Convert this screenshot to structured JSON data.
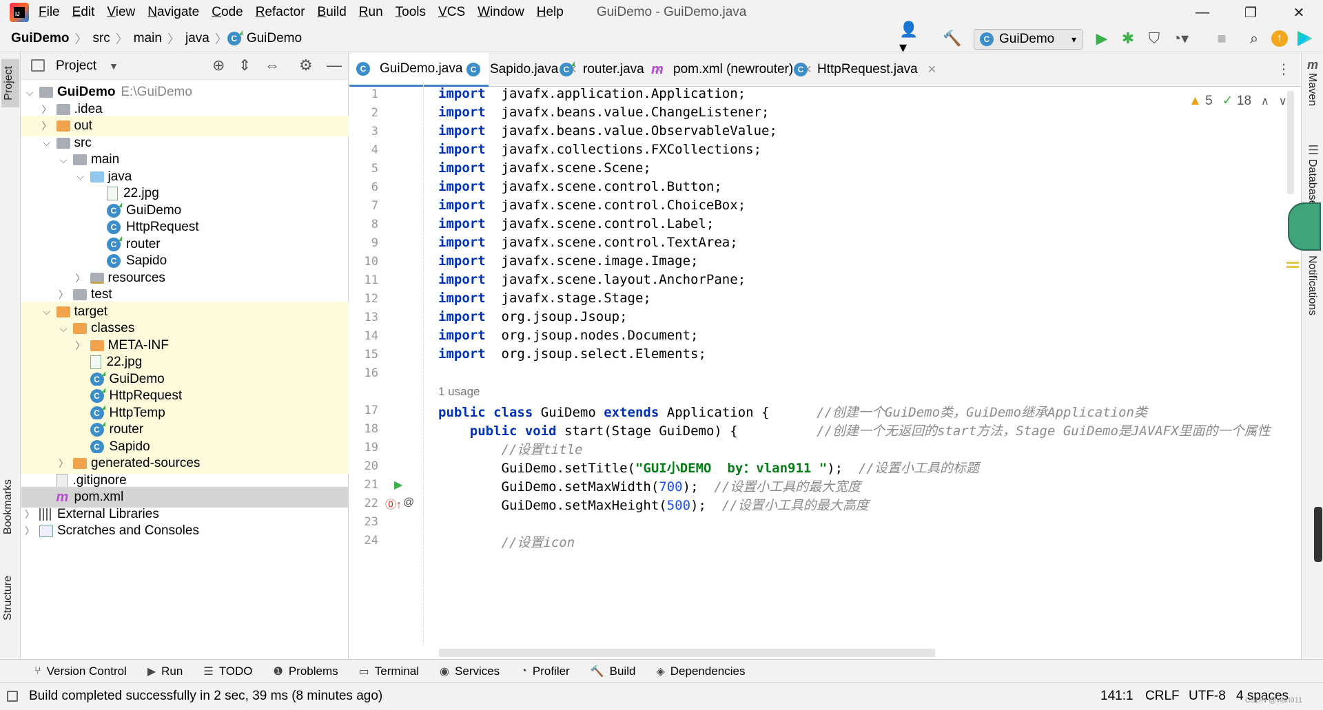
{
  "app": {
    "menu": [
      "File",
      "Edit",
      "View",
      "Navigate",
      "Code",
      "Refactor",
      "Build",
      "Run",
      "Tools",
      "VCS",
      "Window",
      "Help"
    ],
    "window_title": "GuiDemo - GuiDemo.java"
  },
  "breadcrumb": [
    "GuiDemo",
    "src",
    "main",
    "java",
    "GuiDemo"
  ],
  "toolbar": {
    "run_config": "GuiDemo"
  },
  "project_panel": {
    "title": "Project",
    "tree": [
      {
        "label": "GuiDemo",
        "extra": "E:\\GuiDemo",
        "depth": 0,
        "icon": "folder-grey",
        "arrow": "down",
        "hl": ""
      },
      {
        "label": ".idea",
        "depth": 1,
        "icon": "folder-grey",
        "arrow": "right",
        "hl": ""
      },
      {
        "label": "out",
        "depth": 1,
        "icon": "folder-orange",
        "arrow": "right",
        "hl": "yel"
      },
      {
        "label": "src",
        "depth": 1,
        "icon": "folder-grey",
        "arrow": "down",
        "hl": ""
      },
      {
        "label": "main",
        "depth": 2,
        "icon": "folder-grey",
        "arrow": "down",
        "hl": ""
      },
      {
        "label": "java",
        "depth": 3,
        "icon": "folder-blue",
        "arrow": "down",
        "hl": ""
      },
      {
        "label": "22.jpg",
        "depth": 4,
        "icon": "image",
        "arrow": "",
        "hl": ""
      },
      {
        "label": "GuiDemo",
        "depth": 4,
        "icon": "class-run",
        "arrow": "",
        "hl": ""
      },
      {
        "label": "HttpRequest",
        "depth": 4,
        "icon": "class",
        "arrow": "",
        "hl": ""
      },
      {
        "label": "router",
        "depth": 4,
        "icon": "class-run",
        "arrow": "",
        "hl": ""
      },
      {
        "label": "Sapido",
        "depth": 4,
        "icon": "class",
        "arrow": "",
        "hl": ""
      },
      {
        "label": "resources",
        "depth": 3,
        "icon": "folder-res",
        "arrow": "right",
        "hl": ""
      },
      {
        "label": "test",
        "depth": 2,
        "icon": "folder-grey",
        "arrow": "right",
        "hl": ""
      },
      {
        "label": "target",
        "depth": 1,
        "icon": "folder-orange",
        "arrow": "down",
        "hl": "yel"
      },
      {
        "label": "classes",
        "depth": 2,
        "icon": "folder-orange",
        "arrow": "down",
        "hl": "yel"
      },
      {
        "label": "META-INF",
        "depth": 3,
        "icon": "folder-orange",
        "arrow": "right",
        "hl": "yel"
      },
      {
        "label": "22.jpg",
        "depth": 3,
        "icon": "image",
        "arrow": "",
        "hl": "yel"
      },
      {
        "label": "GuiDemo",
        "depth": 3,
        "icon": "class-run",
        "arrow": "",
        "hl": "yel"
      },
      {
        "label": "HttpRequest",
        "depth": 3,
        "icon": "class-run",
        "arrow": "",
        "hl": "yel"
      },
      {
        "label": "HttpTemp",
        "depth": 3,
        "icon": "class-run",
        "arrow": "",
        "hl": "yel"
      },
      {
        "label": "router",
        "depth": 3,
        "icon": "class-run",
        "arrow": "",
        "hl": "yel"
      },
      {
        "label": "Sapido",
        "depth": 3,
        "icon": "class",
        "arrow": "",
        "hl": "yel"
      },
      {
        "label": "generated-sources",
        "depth": 2,
        "icon": "folder-orange",
        "arrow": "right",
        "hl": "yel"
      },
      {
        "label": ".gitignore",
        "depth": 1,
        "icon": "git",
        "arrow": "",
        "hl": ""
      },
      {
        "label": "pom.xml",
        "depth": 1,
        "icon": "maven",
        "arrow": "",
        "hl": "sel"
      },
      {
        "label": "External Libraries",
        "depth": 0,
        "icon": "lib",
        "arrow": "right",
        "hl": ""
      },
      {
        "label": "Scratches and Consoles",
        "depth": 0,
        "icon": "scratch",
        "arrow": "right",
        "hl": ""
      }
    ]
  },
  "editor": {
    "tabs": [
      {
        "label": "GuiDemo.java",
        "icon": "class",
        "active": true
      },
      {
        "label": "Sapido.java",
        "icon": "class",
        "active": false
      },
      {
        "label": "router.java",
        "icon": "class-run",
        "active": false
      },
      {
        "label": "pom.xml (newrouter)",
        "icon": "maven",
        "active": false
      },
      {
        "label": "HttpRequest.java",
        "icon": "class",
        "active": false
      }
    ],
    "inspections": {
      "warnings": "5",
      "checks": "18"
    },
    "usage_hint": "1 usage",
    "lines": [
      {
        "n": "1",
        "t": [
          [
            "kw",
            "import"
          ],
          [
            "",
            "  javafx.application.Application;"
          ]
        ]
      },
      {
        "n": "2",
        "t": [
          [
            "kw",
            "import"
          ],
          [
            "",
            "  javafx.beans.value.ChangeListener;"
          ]
        ]
      },
      {
        "n": "3",
        "t": [
          [
            "kw",
            "import"
          ],
          [
            "",
            "  javafx.beans.value.ObservableValue;"
          ]
        ]
      },
      {
        "n": "4",
        "t": [
          [
            "kw",
            "import"
          ],
          [
            "",
            "  javafx.collections.FXCollections;"
          ]
        ]
      },
      {
        "n": "5",
        "t": [
          [
            "kw",
            "import"
          ],
          [
            "",
            "  javafx.scene.Scene;"
          ]
        ]
      },
      {
        "n": "6",
        "t": [
          [
            "kw",
            "import"
          ],
          [
            "",
            "  javafx.scene.control.Button;"
          ]
        ]
      },
      {
        "n": "7",
        "t": [
          [
            "kw",
            "import"
          ],
          [
            "",
            "  javafx.scene.control.ChoiceBox;"
          ]
        ]
      },
      {
        "n": "8",
        "t": [
          [
            "kw",
            "import"
          ],
          [
            "",
            "  javafx.scene.control.Label;"
          ]
        ]
      },
      {
        "n": "9",
        "t": [
          [
            "kw",
            "import"
          ],
          [
            "",
            "  javafx.scene.control.TextArea;"
          ]
        ]
      },
      {
        "n": "10",
        "t": [
          [
            "kw",
            "import"
          ],
          [
            "",
            "  javafx.scene.image.Image;"
          ]
        ]
      },
      {
        "n": "11",
        "t": [
          [
            "kw",
            "import"
          ],
          [
            "",
            "  javafx.scene.layout.AnchorPane;"
          ]
        ]
      },
      {
        "n": "12",
        "t": [
          [
            "kw",
            "import"
          ],
          [
            "",
            "  javafx.stage.Stage;"
          ]
        ]
      },
      {
        "n": "13",
        "t": [
          [
            "kw",
            "import"
          ],
          [
            "",
            "  org.jsoup.Jsoup;"
          ]
        ]
      },
      {
        "n": "14",
        "t": [
          [
            "kw",
            "import"
          ],
          [
            "",
            "  org.jsoup.nodes.Document;"
          ]
        ]
      },
      {
        "n": "15",
        "t": [
          [
            "kw",
            "import"
          ],
          [
            "",
            "  org.jsoup.select.Elements;"
          ]
        ]
      },
      {
        "n": "16",
        "t": []
      },
      {
        "n": "17",
        "t": [
          [
            "kw",
            "public class"
          ],
          [
            "",
            " GuiDemo "
          ],
          [
            "kw",
            "extends"
          ],
          [
            "",
            " Application {      "
          ],
          [
            "cmt",
            "//创建一个GuiDemo类，GuiDemo继承Application类"
          ]
        ]
      },
      {
        "n": "18",
        "t": [
          [
            "",
            "    "
          ],
          [
            "kw",
            "public void"
          ],
          [
            "",
            " start(Stage GuiDemo) {          "
          ],
          [
            "cmt",
            "//创建一个无返回的start方法，Stage GuiDemo是JAVAFX里面的一个属性"
          ]
        ]
      },
      {
        "n": "19",
        "t": [
          [
            "",
            "        "
          ],
          [
            "cmt",
            "//设置title"
          ]
        ]
      },
      {
        "n": "20",
        "t": [
          [
            "",
            "        GuiDemo.setTitle("
          ],
          [
            "str",
            "\"GUI小DEMO  by：vlan911 \""
          ],
          [
            "",
            ");  "
          ],
          [
            "cmt",
            "//设置小工具的标题"
          ]
        ]
      },
      {
        "n": "21",
        "t": [
          [
            "",
            "        GuiDemo.setMaxWidth("
          ],
          [
            "num",
            "700"
          ],
          [
            "",
            ");  "
          ],
          [
            "cmt",
            "//设置小工具的最大宽度"
          ]
        ]
      },
      {
        "n": "22",
        "t": [
          [
            "",
            "        GuiDemo.setMaxHeight("
          ],
          [
            "num",
            "500"
          ],
          [
            "",
            ");  "
          ],
          [
            "cmt",
            "//设置小工具的最大高度"
          ]
        ]
      },
      {
        "n": "23",
        "t": []
      },
      {
        "n": "24",
        "t": [
          [
            "",
            "        "
          ],
          [
            "cmt",
            "//设置icon"
          ]
        ]
      }
    ]
  },
  "right_tools": [
    "Maven",
    "Database",
    "Notifications"
  ],
  "left_tools": [
    "Project",
    "Bookmarks",
    "Structure"
  ],
  "bottom_tools": [
    {
      "label": "Version Control",
      "icon": "branch-icon"
    },
    {
      "label": "Run",
      "icon": "run-icon"
    },
    {
      "label": "TODO",
      "icon": "list-icon"
    },
    {
      "label": "Problems",
      "icon": "problems-icon"
    },
    {
      "label": "Terminal",
      "icon": "terminal-icon"
    },
    {
      "label": "Services",
      "icon": "services-icon"
    },
    {
      "label": "Profiler",
      "icon": "profiler-icon"
    },
    {
      "label": "Build",
      "icon": "hammer-icon"
    },
    {
      "label": "Dependencies",
      "icon": "layers-icon"
    }
  ],
  "status": {
    "message": "Build completed successfully in 2 sec, 39 ms (8 minutes ago)",
    "position": "141:1",
    "line_sep": "CRLF",
    "encoding": "UTF-8",
    "indent": "4 spaces",
    "watermark": "CSDN @vlan911"
  }
}
